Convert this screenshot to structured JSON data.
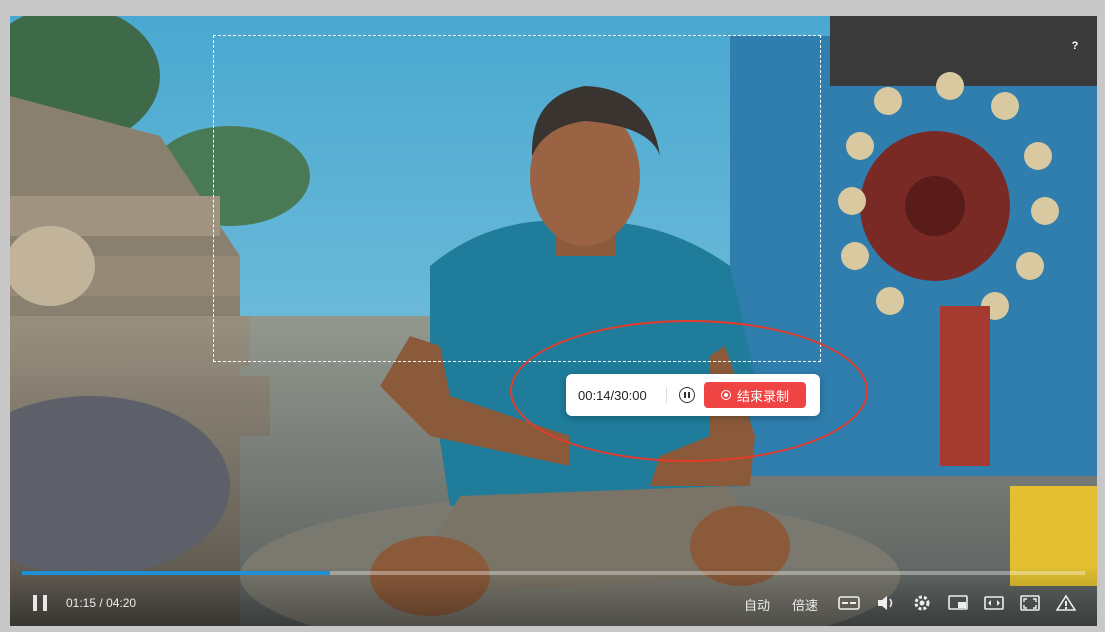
{
  "help": {
    "label": "?"
  },
  "recorder": {
    "time": "00:14/30:00",
    "end_label": "结束录制"
  },
  "player": {
    "progress": 0.29,
    "current_time": "01:15",
    "separator": "/",
    "duration": "04:20",
    "auto_label": "自动",
    "speed_label": "倍速"
  },
  "icons": [
    "help-icon",
    "pause-icon",
    "record-dot-icon",
    "play-pause-icon",
    "subtitle-icon",
    "volume-icon",
    "settings-icon",
    "pip-icon",
    "widescreen-icon",
    "fullscreen-icon",
    "warning-icon"
  ],
  "colors": {
    "accent": "#1f8fd6",
    "record_red": "#ef4444",
    "annotation_red": "#e53b2c"
  }
}
